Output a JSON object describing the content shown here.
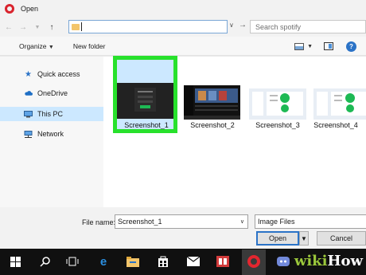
{
  "window": {
    "title": "Open"
  },
  "address": {
    "search_placeholder": "Search spotify"
  },
  "toolbar": {
    "organize": "Organize",
    "new_folder": "New folder"
  },
  "nav": {
    "items": [
      {
        "label": "Quick access",
        "icon": "star-icon"
      },
      {
        "label": "OneDrive",
        "icon": "cloud-icon"
      },
      {
        "label": "This PC",
        "icon": "computer-icon",
        "selected": true
      },
      {
        "label": "Network",
        "icon": "network-icon"
      }
    ]
  },
  "files": [
    {
      "name": "Screenshot_1",
      "selected": true
    },
    {
      "name": "Screenshot_2"
    },
    {
      "name": "Screenshot_3"
    },
    {
      "name": "Screenshot_4"
    }
  ],
  "bottom": {
    "file_name_label": "File name:",
    "file_name_value": "Screenshot_1",
    "file_type": "Image Files",
    "open_label": "Open",
    "cancel_label": "Cancel"
  },
  "watermark": {
    "part1": "wiki",
    "part2": "How"
  },
  "colors": {
    "highlight": "#28e12c",
    "selection": "#cce8ff",
    "accent": "#2b73c7"
  }
}
